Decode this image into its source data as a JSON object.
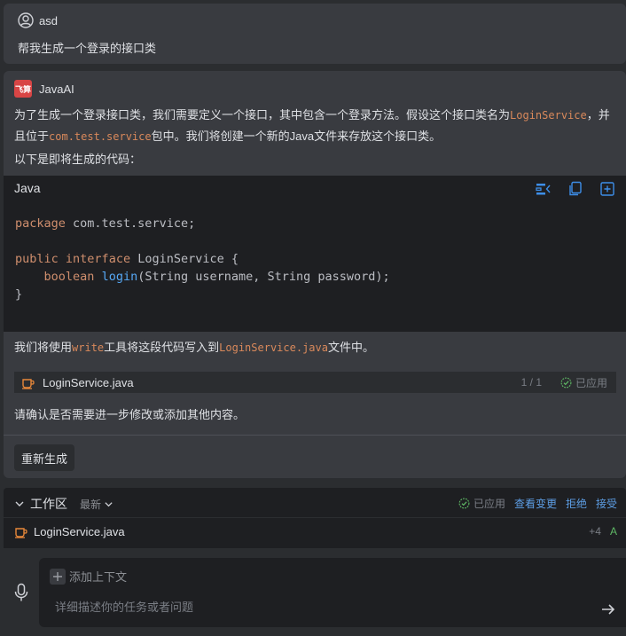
{
  "user": {
    "name": "asd",
    "message": "帮我生成一个登录的接口类"
  },
  "ai": {
    "logo_text": "飞算",
    "name": "JavaAI",
    "p1_a": "为了生成一个登录接口类，我们需要定义一个接口，其中包含一个登录方法。假设这个接口类名为",
    "p1_class": "LoginService",
    "p1_b": "，并",
    "p1_c": "且位于",
    "p1_pkg": "com.test.service",
    "p1_d": "包中。我们将创建一个新的Java文件来存放这个接口类。",
    "p2": "以下是即将生成的代码：",
    "code": {
      "language": "Java",
      "lines": {
        "l1_kw": "package",
        "l1_rest": " com.test.service;",
        "l3_kw1": "public",
        "l3_kw2": "interface",
        "l3_rest": " LoginService {",
        "l4_kw": "boolean",
        "l4_fn": "login",
        "l4_rest": "(String username, String password);",
        "l5": "}"
      }
    },
    "p3_a": "我们将使用",
    "p3_tool": "write",
    "p3_b": "工具将这段代码写入到",
    "p3_file": "LoginService.java",
    "p3_c": "文件中。",
    "file": {
      "name": "LoginService.java",
      "count": "1 / 1",
      "status": "已应用"
    },
    "p4": "请确认是否需要进一步修改或添加其他内容。",
    "regen_label": "重新生成"
  },
  "workspace": {
    "title": "工作区",
    "filter": "最新",
    "status": "已应用",
    "view_changes": "查看变更",
    "reject": "拒绝",
    "accept": "接受",
    "file_name": "LoginService.java",
    "additions": "+4",
    "file_status": "A"
  },
  "input": {
    "add_context": "添加上下文",
    "placeholder": "详细描述你的任务或者问题"
  },
  "colors": {
    "accent_link": "#5d9ee5",
    "highlight": "#d9895b",
    "added": "#5fb865"
  }
}
